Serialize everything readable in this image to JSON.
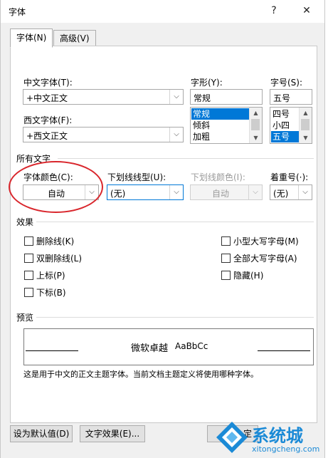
{
  "window": {
    "title": "字体",
    "help_glyph": "?",
    "close_glyph": "✕"
  },
  "tabs": [
    {
      "label": "字体(N)"
    },
    {
      "label": "高级(V)"
    }
  ],
  "cn_font": {
    "label": "中文字体(T):",
    "value": "+中文正文"
  },
  "west_font": {
    "label": "西文字体(F):",
    "value": "+西文正文"
  },
  "style": {
    "label": "字形(Y):",
    "value": "常规",
    "items": [
      "常规",
      "倾斜",
      "加粗"
    ],
    "selected": "常规"
  },
  "size": {
    "label": "字号(S):",
    "value": "五号",
    "items": [
      "四号",
      "小四",
      "五号"
    ],
    "selected": "五号"
  },
  "all_text": {
    "heading": "所有文字",
    "font_color": {
      "label": "字体颜色(C):",
      "value": "自动"
    },
    "underline_type": {
      "label": "下划线线型(U):",
      "value": "(无)"
    },
    "underline_color": {
      "label": "下划线颜色(I):",
      "value": "自动"
    },
    "emphasis": {
      "label": "着重号(·):",
      "value": "(无)"
    }
  },
  "effects": {
    "heading": "效果",
    "left": [
      "删除线(K)",
      "双删除线(L)",
      "上标(P)",
      "下标(B)"
    ],
    "right": [
      "小型大写字母(M)",
      "全部大写字母(A)",
      "隐藏(H)"
    ]
  },
  "preview": {
    "heading": "预览",
    "text_cn": "微软卓越",
    "text_en": "AaBbCc",
    "note": "这是用于中文的正文主题字体。当前文档主题定义将使用哪种字体。"
  },
  "buttons": {
    "default": "设为默认值(D)",
    "text_effects": "文字效果(E)...",
    "ok_partial": "定"
  },
  "watermark": {
    "brand": "系统城",
    "url": "xitongcheng.com"
  },
  "colors": {
    "accent": "#0078d7",
    "annotation_ring": "#d9262c",
    "watermark_blue": "#1b8ad6"
  }
}
